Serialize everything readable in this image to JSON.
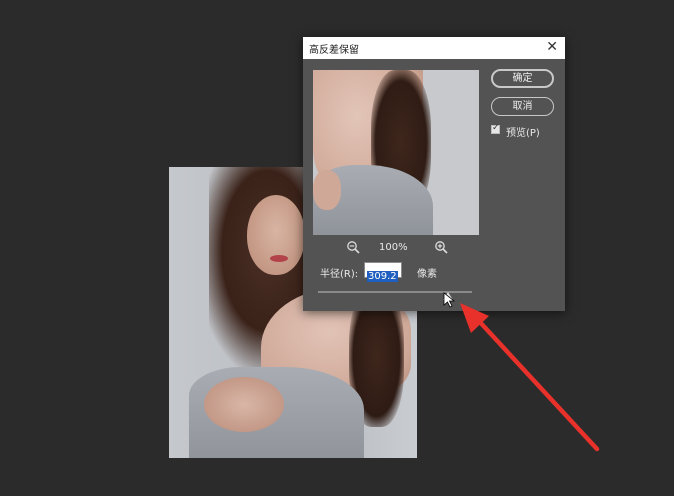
{
  "dialog": {
    "title": "高反差保留",
    "close_symbol": "✕",
    "zoom_level": "100%",
    "radius_label": "半径(R):",
    "radius_value": "309.2",
    "radius_unit": "像素",
    "ok_label": "确定",
    "cancel_label": "取消",
    "preview_label": "预览(P)",
    "preview_checked": true
  },
  "colors": {
    "background": "#2b2b2b",
    "dialog_bg": "#535353",
    "annotation_arrow": "#e8312a",
    "selection": "#1f5fbf"
  },
  "icons": {
    "zoom_out": "zoom-out-icon",
    "zoom_in": "zoom-in-icon",
    "cursor": "arrow-cursor-icon"
  }
}
